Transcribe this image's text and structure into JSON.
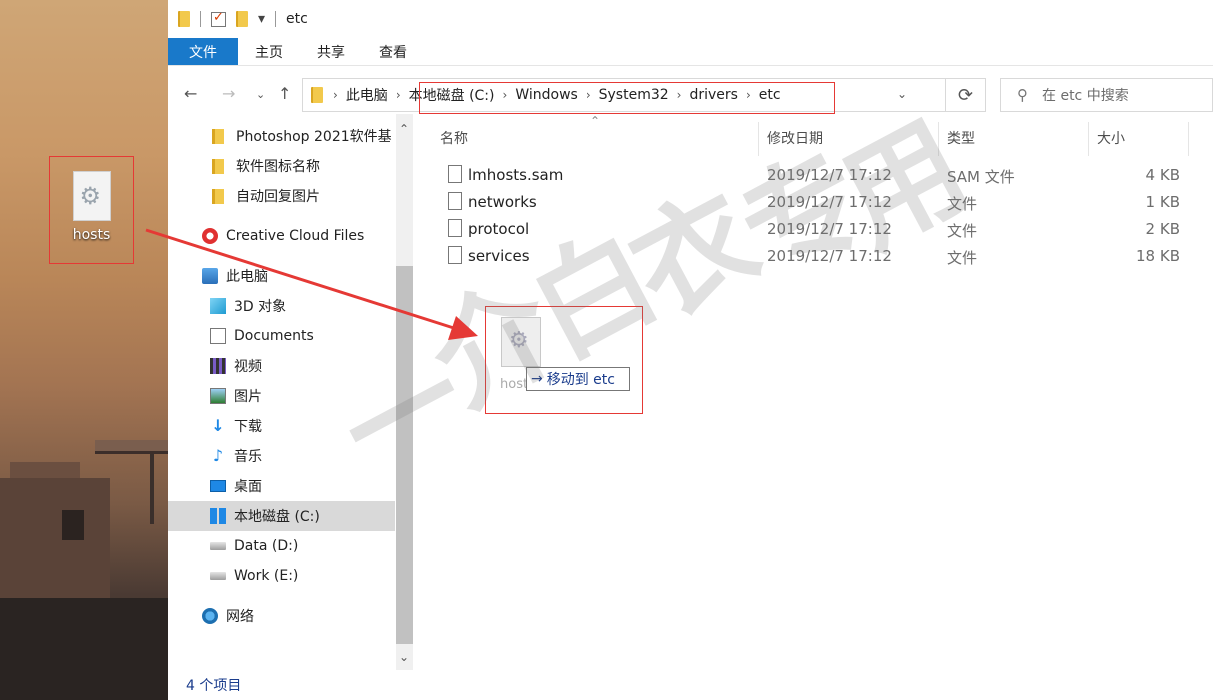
{
  "desktop": {
    "icon_label": "hosts"
  },
  "titlebar": {
    "title": "etc",
    "dropdown": "▾"
  },
  "ribbon": {
    "tabs": [
      "文件",
      "主页",
      "共享",
      "查看"
    ]
  },
  "address": {
    "crumbs": [
      "此电脑",
      "本地磁盘 (C:)",
      "Windows",
      "System32",
      "drivers",
      "etc"
    ]
  },
  "search": {
    "placeholder": "在 etc 中搜索"
  },
  "navpane": {
    "items": [
      {
        "label": "Photoshop 2021软件基",
        "icon": "folder-icon"
      },
      {
        "label": "软件图标名称",
        "icon": "folder-icon"
      },
      {
        "label": "自动回复图片",
        "icon": "folder-icon"
      },
      {
        "label": "Creative Cloud Files",
        "icon": "creative-cloud-icon"
      },
      {
        "label": "此电脑",
        "icon": "this-pc-icon"
      },
      {
        "label": "3D 对象",
        "icon": "3d-objects-icon"
      },
      {
        "label": "Documents",
        "icon": "documents-icon"
      },
      {
        "label": "视频",
        "icon": "videos-icon"
      },
      {
        "label": "图片",
        "icon": "pictures-icon"
      },
      {
        "label": "下载",
        "icon": "downloads-icon"
      },
      {
        "label": "音乐",
        "icon": "music-icon"
      },
      {
        "label": "桌面",
        "icon": "desktop-icon"
      },
      {
        "label": "本地磁盘 (C:)",
        "icon": "windows-drive-icon"
      },
      {
        "label": "Data (D:)",
        "icon": "drive-icon"
      },
      {
        "label": "Work (E:)",
        "icon": "drive-icon"
      },
      {
        "label": "网络",
        "icon": "network-icon"
      }
    ]
  },
  "filelist": {
    "columns": {
      "name": "名称",
      "date": "修改日期",
      "type": "类型",
      "size": "大小"
    },
    "rows": [
      {
        "name": "lmhosts.sam",
        "date": "2019/12/7 17:12",
        "type": "SAM 文件",
        "size": "4 KB"
      },
      {
        "name": "networks",
        "date": "2019/12/7 17:12",
        "type": "文件",
        "size": "1 KB"
      },
      {
        "name": "protocol",
        "date": "2019/12/7 17:12",
        "type": "文件",
        "size": "2 KB"
      },
      {
        "name": "services",
        "date": "2019/12/7 17:12",
        "type": "文件",
        "size": "18 KB"
      }
    ]
  },
  "drag": {
    "ghost_label": "hosts",
    "tooltip": "移动到 etc"
  },
  "status": {
    "count": "4 个项目"
  },
  "watermark": {
    "chars": [
      "一",
      "介",
      "白",
      "衣",
      "专",
      "用"
    ]
  },
  "colors": {
    "accent": "#1979ca",
    "annotation_red": "#e53935"
  }
}
